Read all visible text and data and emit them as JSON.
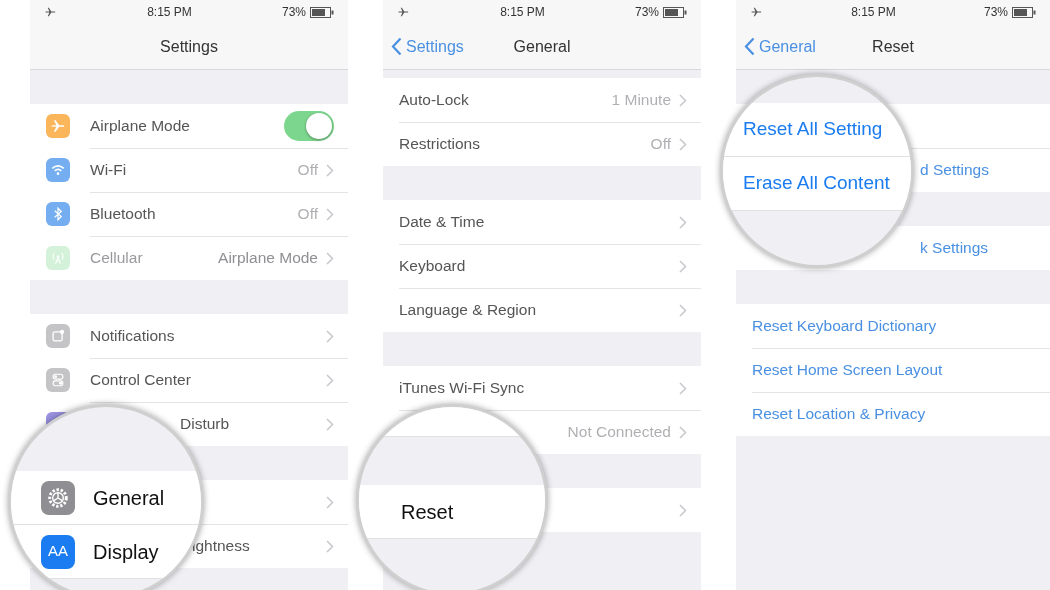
{
  "panels": [
    {
      "status": {
        "time": "8:15 PM",
        "battery": "73%"
      },
      "nav": {
        "title": "Settings"
      },
      "groups": [
        {
          "rows": [
            {
              "kind": "toggle",
              "label": "Airplane Mode",
              "on": true,
              "disabled": false
            },
            {
              "kind": "nav",
              "label": "Wi-Fi",
              "value": "Off",
              "disabled": false
            },
            {
              "kind": "nav",
              "label": "Bluetooth",
              "value": "Off",
              "disabled": false
            },
            {
              "kind": "nav",
              "label": "Cellular",
              "value": "Airplane Mode",
              "disabled": true
            }
          ]
        },
        {
          "rows": [
            {
              "kind": "nav",
              "label": "Notifications",
              "disabled": false
            },
            {
              "kind": "nav",
              "label": "Control Center",
              "disabled": false
            },
            {
              "kind": "nav",
              "label": "Disturb",
              "disabled": false
            }
          ]
        },
        {
          "rows": [
            {
              "kind": "nav"
            },
            {
              "kind": "nav",
              "label": "ightness"
            }
          ]
        }
      ],
      "lens": {
        "rows": [
          {
            "kind": "band"
          },
          {
            "kind": "nav",
            "label": "General"
          },
          {
            "kind": "nav",
            "icon_text": "AA",
            "label": "Display"
          }
        ]
      }
    },
    {
      "status": {
        "time": "8:15 PM",
        "battery": "73%"
      },
      "nav": {
        "back": "Settings",
        "title": "General"
      },
      "groups": [
        {
          "rows": [
            {
              "kind": "nav",
              "label": "Auto-Lock",
              "value": "1 Minute"
            },
            {
              "kind": "nav",
              "label": "Restrictions",
              "value": "Off"
            }
          ]
        },
        {
          "rows": [
            {
              "kind": "nav",
              "label": "Date & Time"
            },
            {
              "kind": "nav",
              "label": "Keyboard"
            },
            {
              "kind": "nav",
              "label": "Language & Region"
            }
          ]
        },
        {
          "rows": [
            {
              "kind": "nav",
              "label": "iTunes Wi-Fi Sync"
            },
            {
              "kind": "nav",
              "value": "Not Connected"
            }
          ]
        },
        {
          "rows": [
            {
              "kind": "nav"
            }
          ]
        }
      ],
      "lens": {
        "rows": [
          {
            "kind": "blank"
          },
          {
            "kind": "band"
          },
          {
            "kind": "nav",
            "label": "Reset"
          },
          {
            "kind": "band"
          }
        ]
      }
    },
    {
      "status": {
        "time": "8:15 PM",
        "battery": "73%"
      },
      "nav": {
        "back": "General",
        "title": "Reset"
      },
      "groups": [
        {
          "rows": [
            {
              "kind": "action"
            },
            {
              "kind": "action",
              "label": "d Settings"
            }
          ]
        },
        {
          "rows": [
            {
              "kind": "action",
              "label": "k Settings"
            }
          ]
        },
        {
          "rows": [
            {
              "kind": "action",
              "label": "Reset Keyboard Dictionary"
            },
            {
              "kind": "action",
              "label": "Reset Home Screen Layout"
            },
            {
              "kind": "action",
              "label": "Reset Location & Privacy"
            }
          ]
        }
      ],
      "lens": {
        "rows": [
          {
            "kind": "band"
          },
          {
            "kind": "action",
            "label": "Reset All Setting"
          },
          {
            "kind": "action",
            "label": "Erase All Content"
          },
          {
            "kind": "band"
          }
        ]
      }
    }
  ]
}
